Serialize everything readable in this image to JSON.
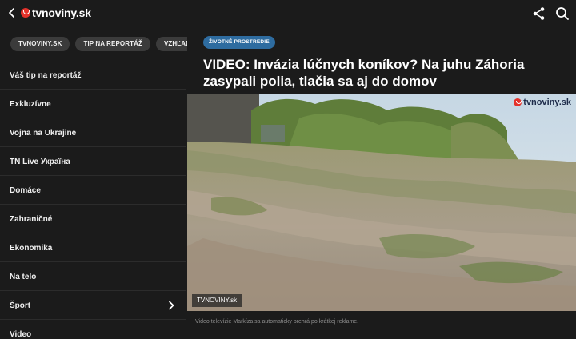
{
  "header": {
    "logo_text": "tvnoviny.sk"
  },
  "chips": [
    "TVNOVINY.SK",
    "TIP NA REPORTÁŽ",
    "VZHĽAD"
  ],
  "menu": [
    {
      "label": "Váš tip na reportáž"
    },
    {
      "label": "Exkluzívne"
    },
    {
      "label": "Vojna na Ukrajine"
    },
    {
      "label": "TN Live Україна"
    },
    {
      "label": "Domáce"
    },
    {
      "label": "Zahraničné"
    },
    {
      "label": "Ekonomika"
    },
    {
      "label": "Na telo"
    },
    {
      "label": "Šport",
      "has_children": true
    },
    {
      "label": "Video"
    }
  ],
  "article": {
    "tag": "ŽIVOTNÉ PROSTREDIE",
    "headline": "VIDEO: Invázia lúčnych koníkov? Na juhu Záhoria zasypali polia, tlačia sa aj do domov",
    "video_watermark": "tvnoviny.sk",
    "video_badge": "TVNOVINY.sk",
    "video_caption": "Video televízie Markíza sa automaticky prehrá po krátkej reklame."
  },
  "colors": {
    "background": "#1b1b1b",
    "tag": "#2e6ca0",
    "logo_red": "#e4322b"
  }
}
